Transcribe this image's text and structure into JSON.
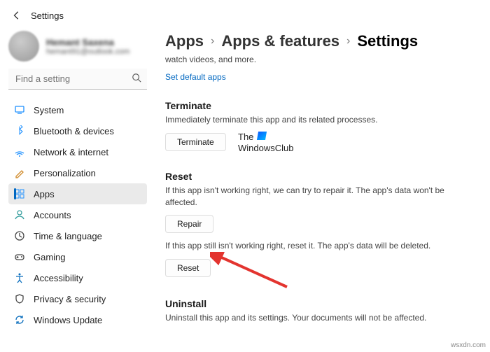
{
  "window": {
    "title": "Settings"
  },
  "user": {
    "name": "Hemant Saxena",
    "email": "hemant91@outlook.com"
  },
  "search": {
    "placeholder": "Find a setting"
  },
  "nav": [
    {
      "label": "System",
      "icon": "system-icon",
      "color": "#1e90ff"
    },
    {
      "label": "Bluetooth & devices",
      "icon": "bluetooth-icon",
      "color": "#1e90ff"
    },
    {
      "label": "Network & internet",
      "icon": "network-icon",
      "color": "#1e90ff"
    },
    {
      "label": "Personalization",
      "icon": "personalization-icon",
      "color": "#d08a2a"
    },
    {
      "label": "Apps",
      "icon": "apps-icon",
      "color": "#1e90ff",
      "active": true
    },
    {
      "label": "Accounts",
      "icon": "accounts-icon",
      "color": "#3aa0a0"
    },
    {
      "label": "Time & language",
      "icon": "time-icon",
      "color": "#444"
    },
    {
      "label": "Gaming",
      "icon": "gaming-icon",
      "color": "#444"
    },
    {
      "label": "Accessibility",
      "icon": "accessibility-icon",
      "color": "#0a6ebd"
    },
    {
      "label": "Privacy & security",
      "icon": "privacy-icon",
      "color": "#444"
    },
    {
      "label": "Windows Update",
      "icon": "update-icon",
      "color": "#0a6ebd"
    }
  ],
  "breadcrumb": {
    "a": "Apps",
    "b": "Apps & features",
    "c": "Settings"
  },
  "intro": "watch videos, and more.",
  "link_default": "Set default apps",
  "sections": {
    "terminate": {
      "title": "Terminate",
      "desc": "Immediately terminate this app and its related processes.",
      "btn": "Terminate"
    },
    "reset": {
      "title": "Reset",
      "desc1": "If this app isn't working right, we can try to repair it. The app's data won't be affected.",
      "btn1": "Repair",
      "desc2": "If this app still isn't working right, reset it. The app's data will be deleted.",
      "btn2": "Reset"
    },
    "uninstall": {
      "title": "Uninstall",
      "desc": "Uninstall this app and its settings. Your documents will not be affected."
    }
  },
  "watermark": {
    "line1": "The",
    "line2": "WindowsClub"
  },
  "credit": "wsxdn.com"
}
